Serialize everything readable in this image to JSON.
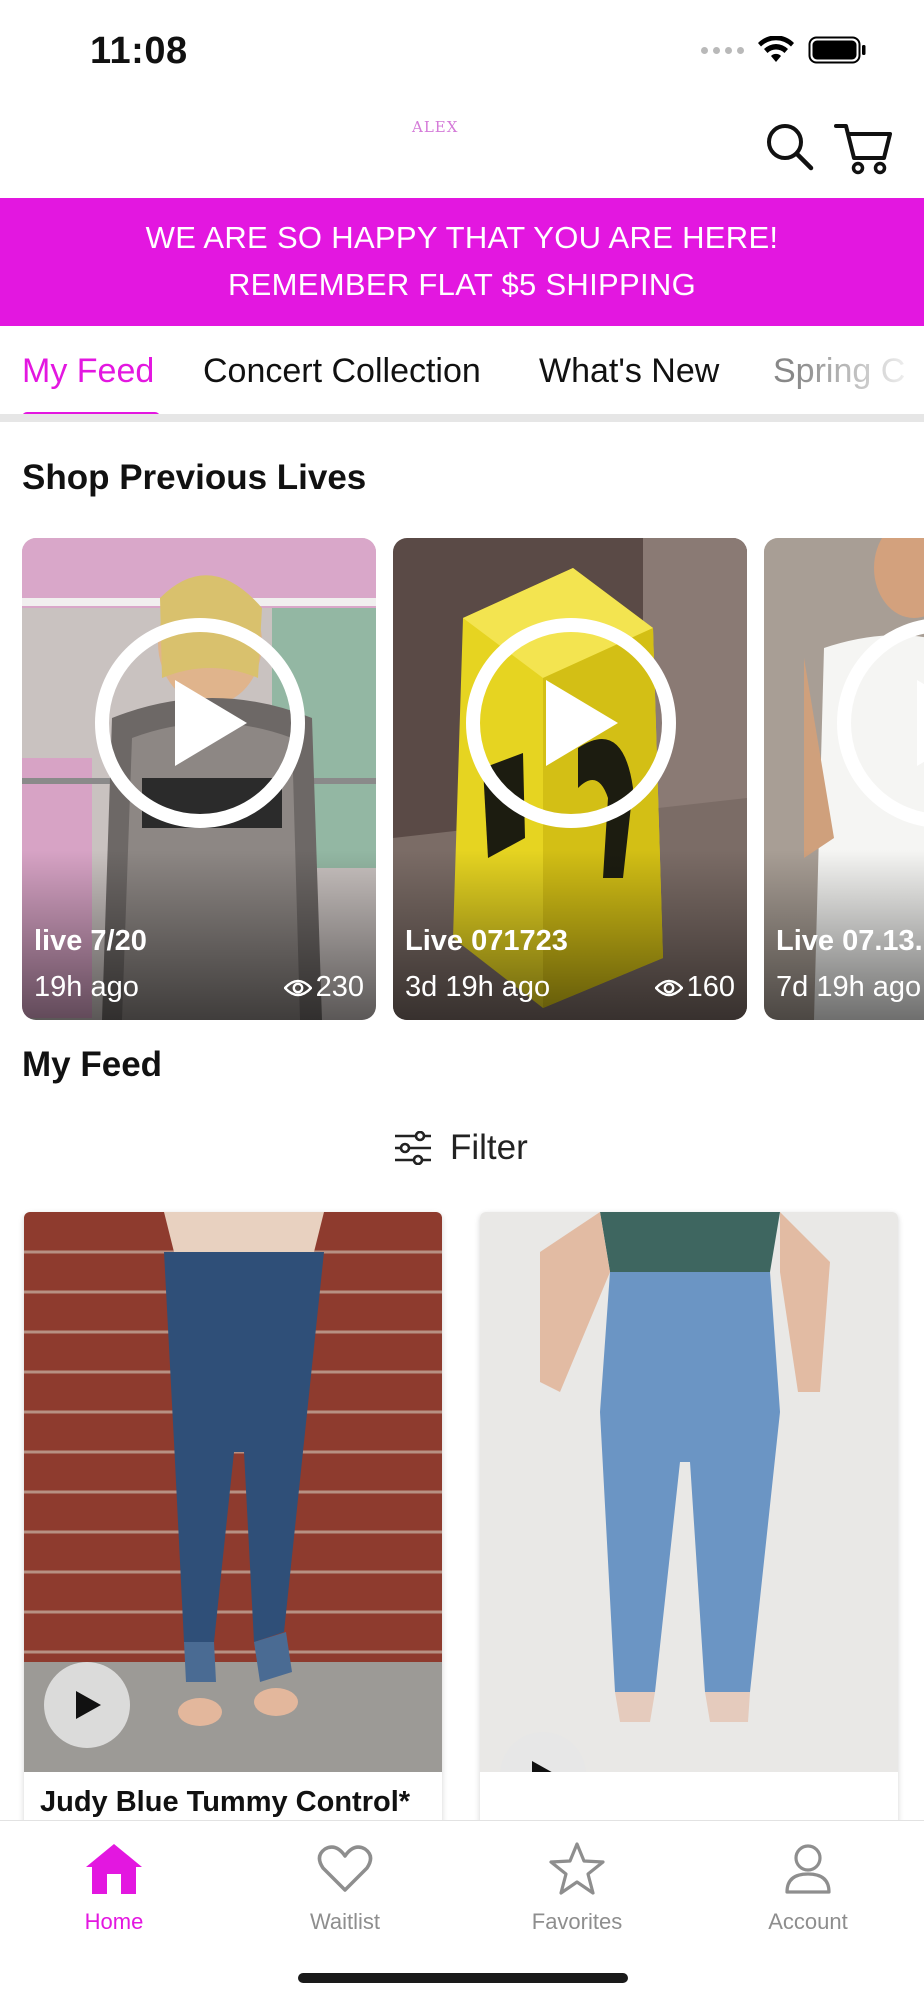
{
  "status_bar": {
    "time": "11:08"
  },
  "header": {
    "logo_text": "ALEX",
    "icons": [
      "search-icon",
      "cart-icon"
    ]
  },
  "banner": {
    "line1": "WE ARE SO HAPPY THAT YOU ARE HERE!",
    "line2": "REMEMBER FLAT $5 SHIPPING",
    "color": "#e317e0"
  },
  "tabs": [
    {
      "label": "My Feed",
      "active": true
    },
    {
      "label": "Concert Collection",
      "active": false
    },
    {
      "label": "What's New",
      "active": false
    },
    {
      "label": "Spring C",
      "active": false
    }
  ],
  "previous_lives": {
    "title": "Shop Previous Lives",
    "items": [
      {
        "title": "live 7/20",
        "time": "19h ago",
        "views": "230"
      },
      {
        "title": "Live 071723",
        "time": "3d 19h ago",
        "views": "160"
      },
      {
        "title": "Live 07.13.",
        "time": "7d 19h ago",
        "views": ""
      }
    ]
  },
  "feed": {
    "title": "My Feed",
    "filter_label": "Filter",
    "products": [
      {
        "name": "Judy Blue Tummy Control*"
      },
      {
        "name": ""
      }
    ]
  },
  "tabbar": {
    "items": [
      {
        "label": "Home",
        "icon": "home-icon",
        "active": true
      },
      {
        "label": "Waitlist",
        "icon": "heart-icon",
        "active": false
      },
      {
        "label": "Favorites",
        "icon": "star-icon",
        "active": false
      },
      {
        "label": "Account",
        "icon": "person-icon",
        "active": false
      }
    ]
  },
  "colors": {
    "accent": "#e317e0",
    "inactive": "#8e8e8e"
  }
}
